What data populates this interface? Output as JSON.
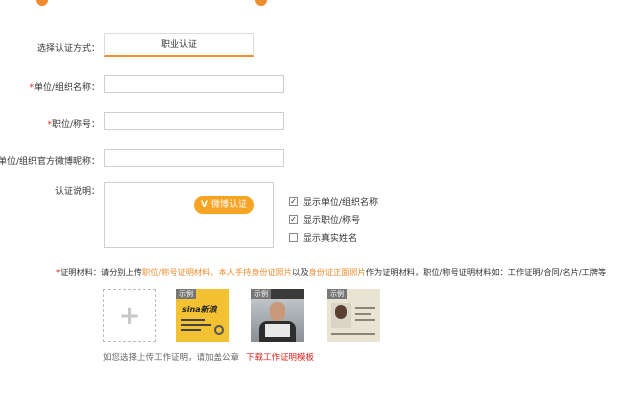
{
  "form": {
    "method_label": "选择认证方式：",
    "method_tab": "职业认证",
    "org_name_label": "单位/组织名称：",
    "title_label": "职位/称号：",
    "weibo_label": "单位/组织官方微博昵称：",
    "desc_label": "认证说明：",
    "required_mark": "*",
    "v_button": "微博认证",
    "v_icon": "V"
  },
  "options": [
    {
      "label": "显示单位/组织名称",
      "checked": true
    },
    {
      "label": "显示职位/称号",
      "checked": true
    },
    {
      "label": "显示真实姓名",
      "checked": false
    }
  ],
  "materials": {
    "label": "证明材料：",
    "text_1": "请分别上传",
    "highlight_1": "职位/称号证明材料、本人手持身份证照片",
    "text_2": "以及",
    "highlight_2": "身份证正面照片",
    "text_3": "作为证明材料，职位/称号证明材料如：工作证明/合同/名片/工牌等",
    "upload_icon": "+",
    "sample_tag": "示例",
    "sample_brand": "sina新浪",
    "hint": "如您选择上传工作证明，请加盖公章",
    "template_link": "下载工作证明模板"
  },
  "colors": {
    "accent": "#f08c2d",
    "required": "#e2231a",
    "button": "#f7a425"
  }
}
